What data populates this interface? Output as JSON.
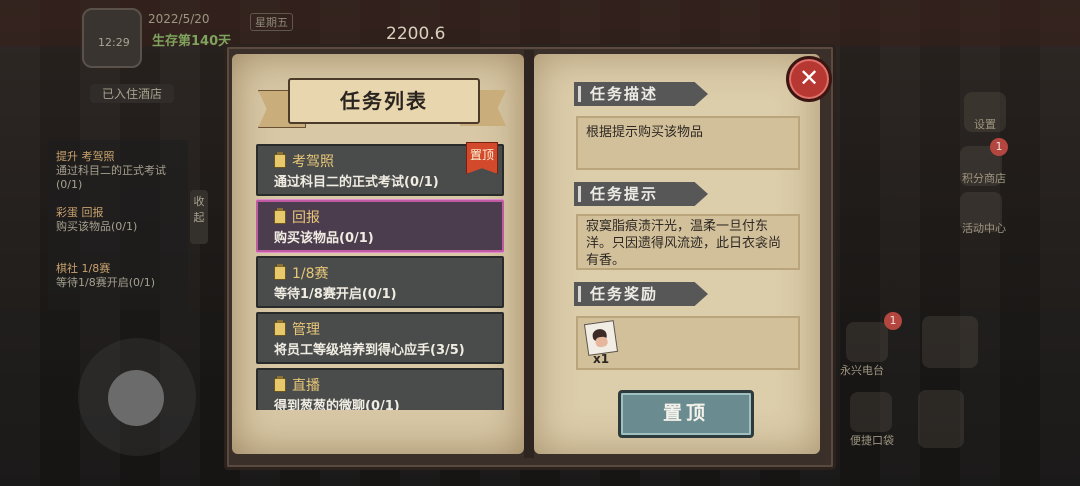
{
  "hud": {
    "date": "2022/5/20",
    "weekday": "星期五",
    "survive_days": "生存第140天",
    "money": "2200.6",
    "clock": "12:29",
    "hotel_status": "已入住酒店"
  },
  "side_quests": [
    {
      "title": "提升 考驾照",
      "desc": "通过科目二的正式考试(0/1)"
    },
    {
      "title": "彩蛋 回报",
      "desc": "购买该物品(0/1)"
    },
    {
      "title": "棋社 1/8赛",
      "desc": "等待1/8赛开启(0/1)"
    }
  ],
  "collapse_label": "收起",
  "dialog": {
    "title": "任务列表",
    "tasks": [
      {
        "name": "考驾照",
        "desc": "通过科目二的正式考试(0/1)",
        "pinned": true,
        "pin_label": "置顶"
      },
      {
        "name": "回报",
        "desc": "购买该物品(0/1)",
        "selected": true
      },
      {
        "name": "1/8赛",
        "desc": "等待1/8赛开启(0/1)"
      },
      {
        "name": "管理",
        "desc": "将员工等级培养到得心应手(3/5)"
      },
      {
        "name": "直播",
        "desc": "得到葱葱的微聊(0/1)"
      }
    ],
    "description_header": "任务描述",
    "description_text": "根据提示购买该物品",
    "hint_header": "任务提示",
    "hint_text": "寂寞脂痕渍汗光，温柔一旦付东洋。只因遗得风流迹，此日衣衾尚有香。",
    "reward_header": "任务奖励",
    "reward_item_icon": "portrait-photo-icon",
    "reward_qty": "x1",
    "pin_button_label": "置顶",
    "close_icon": "close-x-icon"
  },
  "right_side": {
    "labels": [
      "设置",
      "积分商店",
      "活动中心",
      "永兴电台",
      "便捷口袋"
    ],
    "badge_count": "1"
  },
  "colors": {
    "selected_border": "#c05aa3",
    "pin_tag": "#d24a2b",
    "close_button": "#b73732",
    "pin_button": "#6a8b8f",
    "section_header": "#575757"
  }
}
